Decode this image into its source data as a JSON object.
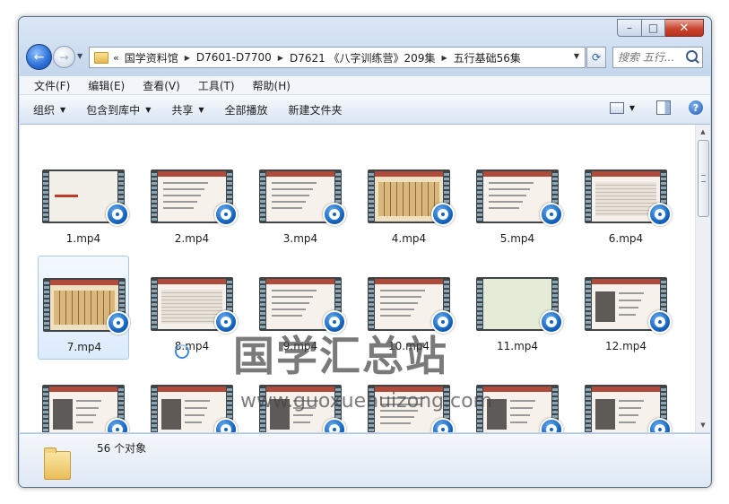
{
  "window": {
    "caption_buttons": {
      "minimize": "–",
      "maximize": "□",
      "close": "✕"
    }
  },
  "nav": {
    "back_glyph": "←",
    "forward_glyph": "→",
    "address_chevron": "«",
    "breadcrumbs": [
      "国学资料馆",
      "D7601-D7700",
      "D7621 《八字训练营》209集",
      "五行基础56集"
    ],
    "refresh_glyph": "⟳",
    "search_placeholder": "搜索 五行..."
  },
  "menubar": [
    "文件(F)",
    "编辑(E)",
    "查看(V)",
    "工具(T)",
    "帮助(H)"
  ],
  "toolbar": {
    "organize": "组织",
    "include_library": "包含到库中",
    "share": "共享",
    "play_all": "全部播放",
    "new_folder": "新建文件夹",
    "help": "?"
  },
  "files": [
    {
      "name": "1.mp4",
      "style": "title"
    },
    {
      "name": "2.mp4",
      "style": "text"
    },
    {
      "name": "3.mp4",
      "style": "text"
    },
    {
      "name": "4.mp4",
      "style": "table-gold"
    },
    {
      "name": "5.mp4",
      "style": "text"
    },
    {
      "name": "6.mp4",
      "style": "grid"
    },
    {
      "name": "7.mp4",
      "style": "table-gold",
      "selected": true
    },
    {
      "name": "8.mp4",
      "style": "grid"
    },
    {
      "name": "9.mp4",
      "style": "text"
    },
    {
      "name": "10.mp4",
      "style": "text"
    },
    {
      "name": "11.mp4",
      "style": "green"
    },
    {
      "name": "12.mp4",
      "style": "dark"
    },
    {
      "name": "",
      "style": "dark"
    },
    {
      "name": "",
      "style": "dark"
    },
    {
      "name": "",
      "style": "dark"
    },
    {
      "name": "",
      "style": "text"
    },
    {
      "name": "",
      "style": "dark"
    },
    {
      "name": "",
      "style": "dark"
    }
  ],
  "watermark": {
    "title": "国学汇总站",
    "url": "www.guoxuehuizong.com"
  },
  "status": {
    "object_count": "56 个对象"
  }
}
